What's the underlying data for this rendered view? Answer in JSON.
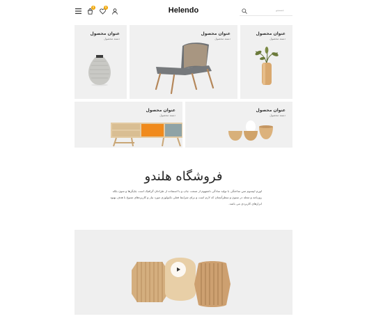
{
  "header": {
    "logo": "Helendo",
    "search_placeholder": "جستجو",
    "cart_count": "0",
    "wishlist_count": "0",
    "icons": [
      "menu-icon",
      "cart-icon",
      "heart-icon",
      "user-icon",
      "search-icon"
    ]
  },
  "products": [
    {
      "title": "عنوان محصول",
      "category": "دسته محصول"
    },
    {
      "title": "عنوان محصول",
      "category": "دسته محصول"
    },
    {
      "title": "عنوان محصول",
      "category": "دسته محصول"
    },
    {
      "title": "عنوان محصول",
      "category": "دسته محصول"
    },
    {
      "title": "عنوان محصول",
      "category": "دسته محصول"
    }
  ],
  "store": {
    "title": "فروشگاه هلندو",
    "description": "لورم ایپسوم متن ساختگی با تولید سادگی نامفهوم از صنعت چاپ و با استفاده از طراحان گرافیک است چاپگرها و متون بلکه روزنامه و مجله در ستون و سطرآنچنان که لازم است و برای شرایط فعلی تکنولوژی مورد نیاز و کاربردهای متنوع با هدف بهبود ابزارهای کاربردی می باشد."
  },
  "video": {
    "label": "play-icon"
  },
  "colors": {
    "card_bg": "#f0f0f0",
    "accent": "#f0a500",
    "orange_panel": "#f08a1c",
    "teal_panel": "#8fa3a6"
  }
}
